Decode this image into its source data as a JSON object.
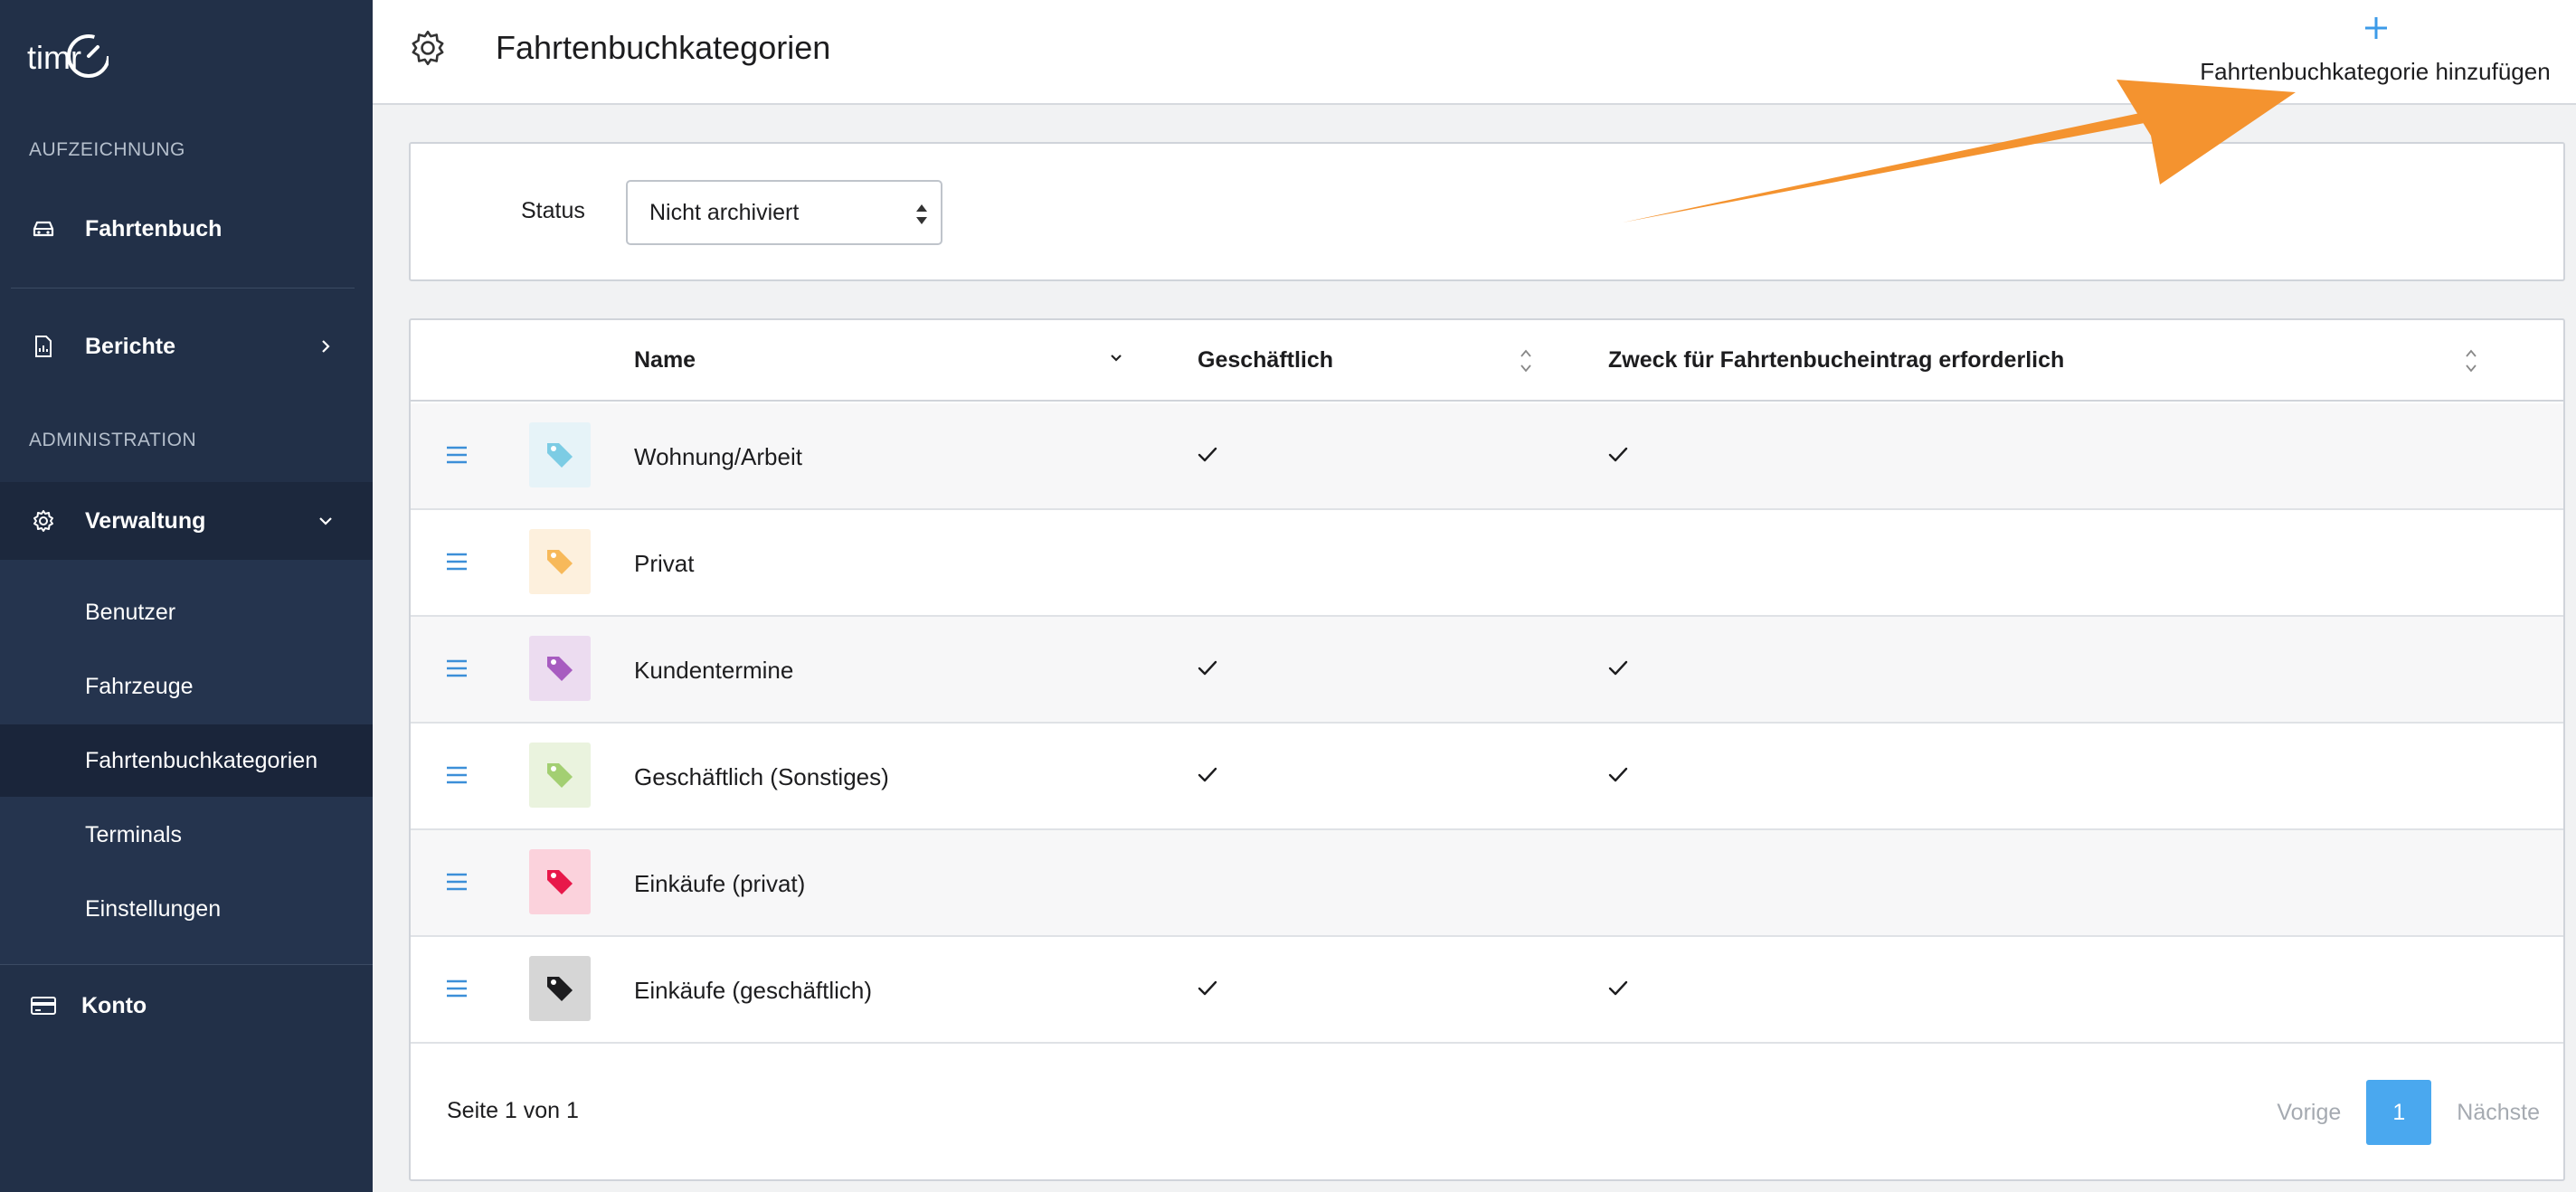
{
  "app": {
    "logo_text": "timr"
  },
  "sidebar": {
    "section_recording": "AUFZEICHNUNG",
    "section_admin": "ADMINISTRATION",
    "items": {
      "logbook": "Fahrtenbuch",
      "reports": "Berichte",
      "management": "Verwaltung",
      "account": "Konto"
    },
    "sub_items": [
      "Benutzer",
      "Fahrzeuge",
      "Fahrtenbuchkategorien",
      "Terminals",
      "Einstellungen"
    ],
    "active_sub_item": "Fahrtenbuchkategorien"
  },
  "header": {
    "title": "Fahrtenbuchkategorien",
    "add_label": "Fahrtenbuchkategorie hinzufügen"
  },
  "filter": {
    "status_label": "Status",
    "status_value": "Nicht archiviert"
  },
  "table": {
    "columns": {
      "name": "Name",
      "business": "Geschäftlich",
      "purpose": "Zweck für Fahrtenbucheintrag erforderlich"
    },
    "rows": [
      {
        "name": "Wohnung/Arbeit",
        "business": true,
        "purpose": true,
        "color": "#7ccce4",
        "bg": "#e6f3f8"
      },
      {
        "name": "Privat",
        "business": false,
        "purpose": false,
        "color": "#f7b95a",
        "bg": "#fdf0dd"
      },
      {
        "name": "Kundentermine",
        "business": true,
        "purpose": true,
        "color": "#a75cc0",
        "bg": "#ecdcf0"
      },
      {
        "name": "Geschäftlich (Sonstiges)",
        "business": true,
        "purpose": true,
        "color": "#a3cf72",
        "bg": "#eaf3de"
      },
      {
        "name": "Einkäufe (privat)",
        "business": false,
        "purpose": false,
        "color": "#e8184a",
        "bg": "#fbd2dc"
      },
      {
        "name": "Einkäufe (geschäftlich)",
        "business": true,
        "purpose": true,
        "color": "#1d1d1f",
        "bg": "#d6d6d6"
      }
    ]
  },
  "pagination": {
    "page_info": "Seite 1 von 1",
    "prev": "Vorige",
    "current": "1",
    "next": "Nächste"
  },
  "colors": {
    "sidebar_bg": "#223048",
    "accent": "#4aa8ef",
    "annotation_arrow": "#f4932f"
  }
}
